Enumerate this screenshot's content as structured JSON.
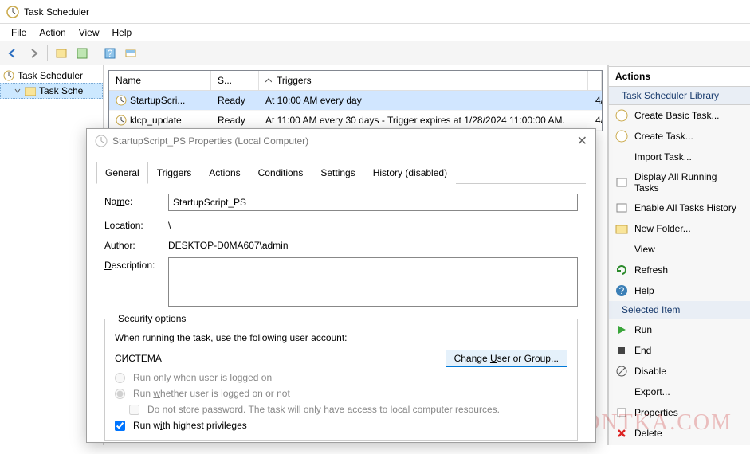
{
  "window": {
    "title": "Task Scheduler"
  },
  "menus": {
    "file": "File",
    "action": "Action",
    "view": "View",
    "help": "Help"
  },
  "tree": {
    "root": "Task Scheduler",
    "lib": "Task Sche"
  },
  "list": {
    "headers": {
      "name": "Name",
      "status": "S...",
      "triggers": "Triggers"
    },
    "rows": [
      {
        "name": "StartupScri...",
        "status": "Ready",
        "triggers": "At 10:00 AM every day",
        "nextrun": "4/"
      },
      {
        "name": "klcp_update",
        "status": "Ready",
        "triggers": "At 11:00 AM every 30 days - Trigger expires at 1/28/2024 11:00:00 AM.",
        "nextrun": "4/"
      }
    ]
  },
  "actions": {
    "header": "Actions",
    "lib_section": "Task Scheduler Library",
    "items1": [
      "Create Basic Task...",
      "Create Task...",
      "Import Task...",
      "Display All Running Tasks",
      "Enable All Tasks History",
      "New Folder...",
      "View",
      "Refresh",
      "Help"
    ],
    "selected_section": "Selected Item",
    "items2": [
      "Run",
      "End",
      "Disable",
      "Export...",
      "Properties",
      "Delete"
    ]
  },
  "dialog": {
    "title": "StartupScript_PS Properties (Local Computer)",
    "tabs": [
      "General",
      "Triggers",
      "Actions",
      "Conditions",
      "Settings",
      "History (disabled)"
    ],
    "labels": {
      "name": "Name:",
      "location": "Location:",
      "author": "Author:",
      "description": "Description:"
    },
    "values": {
      "name": "StartupScript_PS",
      "location": "\\",
      "author": "DESKTOP-D0MA607\\admin",
      "description": ""
    },
    "security": {
      "legend": "Security options",
      "when_running": "When running the task, use the following user account:",
      "user": "СИСТЕМА",
      "change_user": "Change User or Group...",
      "run_logged": "Run only when user is logged on",
      "run_whether": "Run whether user is logged on or not",
      "no_store": "Do not store password.  The task will only have access to local computer resources.",
      "highest": "Run with highest privileges"
    }
  },
  "watermark": "REMONTKA.COM"
}
